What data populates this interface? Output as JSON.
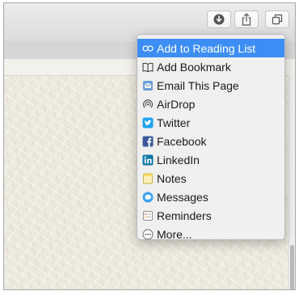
{
  "toolbar": {
    "buttons": [
      {
        "name": "download",
        "icon": "download-icon"
      },
      {
        "name": "share",
        "icon": "share-icon"
      },
      {
        "name": "tabs",
        "icon": "tab-overview-icon"
      }
    ]
  },
  "share_menu": {
    "items": [
      {
        "label": "Add to Reading List",
        "icon": "reading-list-icon",
        "selected": true
      },
      {
        "label": "Add Bookmark",
        "icon": "bookmark-icon"
      },
      {
        "label": "Email This Page",
        "icon": "mail-icon"
      },
      {
        "label": "AirDrop",
        "icon": "airdrop-icon"
      },
      {
        "label": "Twitter",
        "icon": "twitter-icon"
      },
      {
        "label": "Facebook",
        "icon": "facebook-icon"
      },
      {
        "label": "LinkedIn",
        "icon": "linkedin-icon"
      },
      {
        "label": "Notes",
        "icon": "notes-icon"
      },
      {
        "label": "Messages",
        "icon": "messages-icon"
      },
      {
        "label": "Reminders",
        "icon": "reminders-icon"
      },
      {
        "label": "More...",
        "icon": "more-icon"
      }
    ]
  },
  "colors": {
    "selection": "#3d8ef4",
    "twitter": "#1da1f2",
    "facebook": "#3b5998",
    "linkedin": "#0e76a8",
    "notes": "#f5d55a"
  }
}
